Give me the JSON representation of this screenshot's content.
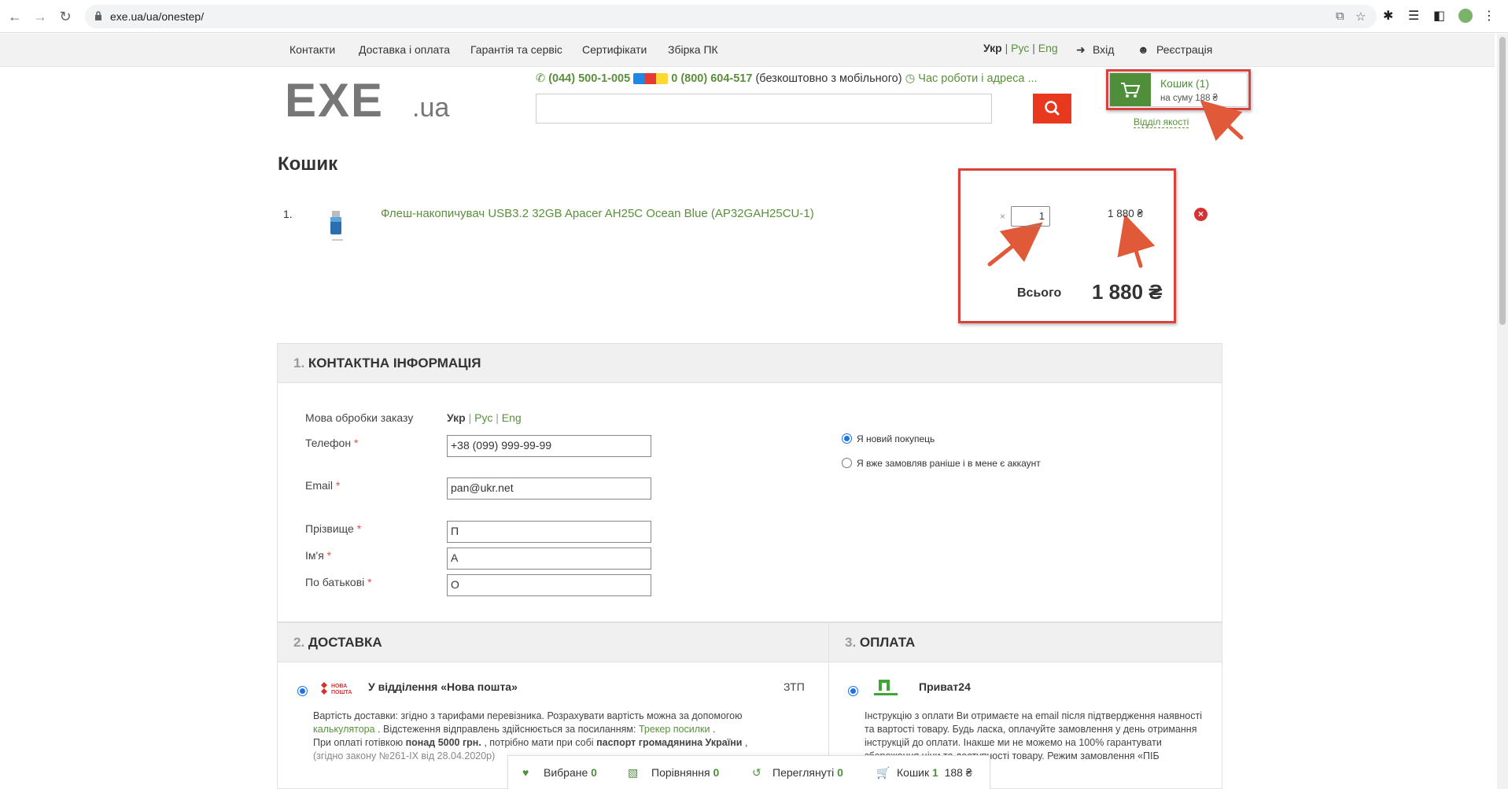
{
  "browser": {
    "url": "exe.ua/ua/onestep/"
  },
  "topnav": {
    "links": [
      "Контакти",
      "Доставка і оплата",
      "Гарантія та сервіс",
      "Сертифікати",
      "Збірка ПК"
    ],
    "lang_ukr": "Укр",
    "lang_rus": "Рус",
    "lang_eng": "Eng",
    "sep": "|",
    "login": "Вхід",
    "register": "Реєстрація"
  },
  "header": {
    "phone1": "(044) 500-1-005",
    "phone2": "0 (800) 604-517",
    "phone2_note": "(безкоштовно з мобільного)",
    "hours": "Час роботи і адреса ...",
    "cart_title": "Кошик (1)",
    "cart_sum": "на суму 188 ₴",
    "quality": "Відділ якості"
  },
  "cart": {
    "title": "Кошик",
    "item": {
      "num": "1.",
      "name": "Флеш-накопичувач USB3.2 32GB Apacer AH25C Ocean Blue (AP32GAH25CU-1)",
      "qty_prefix": "×",
      "qty": "1",
      "price": "1 880 ₴"
    },
    "total_label": "Всього",
    "total_value": "1 880 ₴"
  },
  "contact": {
    "heading_num": "1.",
    "heading": "КОНТАКТНА ІНФОРМАЦІЯ",
    "lang_label": "Мова обробки заказу",
    "lang_ukr": "Укр",
    "lang_rus": "Рус",
    "lang_eng": "Eng",
    "phone_label": "Телефон",
    "phone_value": "+38        (099) 999-99-99",
    "email_label": "Email",
    "email_value": "pan@ukr.net",
    "surname_label": "Прізвище",
    "surname_value": "П",
    "name_label": "Ім'я",
    "name_value": "А",
    "patronymic_label": "По батькові",
    "patronymic_value": "О",
    "req": "*",
    "new_buyer": "Я новий покупець",
    "existing_buyer": "Я вже замовляв раніше і в мене є аккаунт"
  },
  "delivery": {
    "heading_num": "2.",
    "heading": "ДОСТАВКА",
    "option": "У відділення «Нова пошта»",
    "code": "ЗТП",
    "line1": "Вартість доставки: згідно з тарифами перевізника. Розрахувати вартість можна за допомогою",
    "calc_link": "калькулятора",
    "line2": ". Відстеження відправлень здійснюється за посиланням:",
    "tracker_link": "Трекер посилки",
    "line2_end": ".",
    "line3_a": "При оплаті готівкою",
    "line3_b": "понад 5000 грн.",
    "line3_c": ", потрібно мати при собі",
    "line3_d": "паспорт громадянина України",
    "line3_e": ",",
    "line4": "(згідно закону №261-IX від 28.04.2020р)"
  },
  "payment": {
    "heading_num": "3.",
    "heading": "ОПЛАТА",
    "option": "Приват24",
    "text": "Інструкцію з оплати Ви отримаєте на email після підтвердження наявності та вартості товару. Будь ласка, оплачуйте замовлення у день отримання інструкцій до оплати. Інакше ми не можемо на 100% гарантувати збереження ціни та доступності товару. Режим замовлення «ПІБ"
  },
  "bottombar": {
    "fav_label": "Вибране",
    "fav_count": "0",
    "compare_label": "Порівняння",
    "compare_count": "0",
    "viewed_label": "Переглянуті",
    "viewed_count": "0",
    "cart_label": "Кошик",
    "cart_count": "1",
    "cart_sum": "188 ₴"
  },
  "colors": {
    "accent_green": "#4f8f3a",
    "search_red": "#e8381d",
    "annotation_red": "#d9413c"
  }
}
